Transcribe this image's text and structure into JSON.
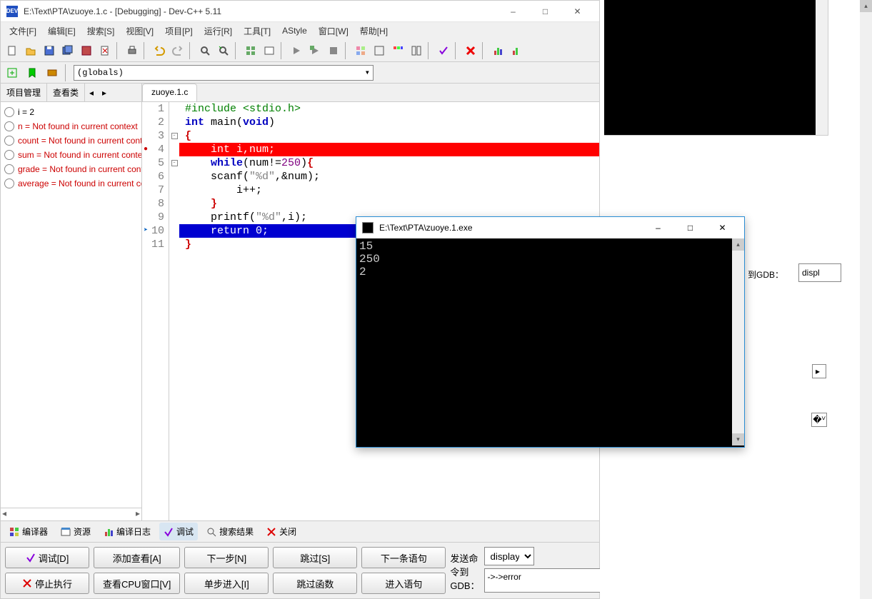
{
  "title": "E:\\Text\\PTA\\zuoye.1.c - [Debugging] - Dev-C++ 5.11",
  "menus": [
    "文件[F]",
    "编辑[E]",
    "搜索[S]",
    "视图[V]",
    "项目[P]",
    "运行[R]",
    "工具[T]",
    "AStyle",
    "窗口[W]",
    "帮助[H]"
  ],
  "globals_combo": "(globals)",
  "side_tabs": {
    "project": "项目管理",
    "classes": "查看类"
  },
  "watches": [
    {
      "text": "i = 2",
      "ok": true
    },
    {
      "text": "n = Not found in current context",
      "ok": false
    },
    {
      "text": "count = Not found in current context",
      "ok": false
    },
    {
      "text": "sum = Not found in current context",
      "ok": false
    },
    {
      "text": "grade = Not found in current context",
      "ok": false
    },
    {
      "text": "average = Not found in current context",
      "ok": false
    }
  ],
  "editor_tab": "zuoye.1.c",
  "code": {
    "lines": [
      {
        "n": 1,
        "html": "<span class='pp'>#include</span> <span class='inc'>&lt;stdio.h&gt;</span>"
      },
      {
        "n": 2,
        "html": "<span class='kw'>int</span> main(<span class='kw'>void</span>)"
      },
      {
        "n": 3,
        "html": "<span class='punc'>{</span>",
        "fold": "-"
      },
      {
        "n": 4,
        "html": "    int i,num;",
        "hl": "red",
        "bp": true
      },
      {
        "n": 5,
        "html": "    <span class='kw'>while</span>(num!=<span class='num'>250</span>)<span class='punc'>{</span>",
        "fold": "-"
      },
      {
        "n": 6,
        "html": "    scanf(<span class='str'>\"%d\"</span>,&amp;num);"
      },
      {
        "n": 7,
        "html": "        i++;"
      },
      {
        "n": 8,
        "html": "    <span class='punc'>}</span>"
      },
      {
        "n": 9,
        "html": "    printf(<span class='str'>\"%d\"</span>,i);"
      },
      {
        "n": 10,
        "html": "    return 0;",
        "hl": "blue",
        "arrow": true
      },
      {
        "n": 11,
        "html": "<span class='punc'>}</span>"
      }
    ]
  },
  "bottom_tabs": {
    "compiler": "编译器",
    "resources": "资源",
    "compile_log": "编译日志",
    "debug": "调试",
    "search_results": "搜索结果",
    "close": "关闭"
  },
  "debug_buttons": {
    "debug": "调试[D]",
    "add_watch": "添加查看[A]",
    "next": "下一步[N]",
    "step_over": "跳过[S]",
    "next_stmt": "下一条语句",
    "stop": "停止执行",
    "cpu_window": "查看CPU窗口[V]",
    "step_into": "单步进入[I]",
    "skip_func": "跳过函数",
    "into_stmt": "进入语句"
  },
  "gdb": {
    "label": "发送命令到GDB：",
    "select": "display",
    "output": "->->error"
  },
  "gdb_frag_label": "到GDB：",
  "gdb_frag_value": "displ",
  "console": {
    "title": "E:\\Text\\PTA\\zuoye.1.exe",
    "output": "15\n250\n2"
  }
}
